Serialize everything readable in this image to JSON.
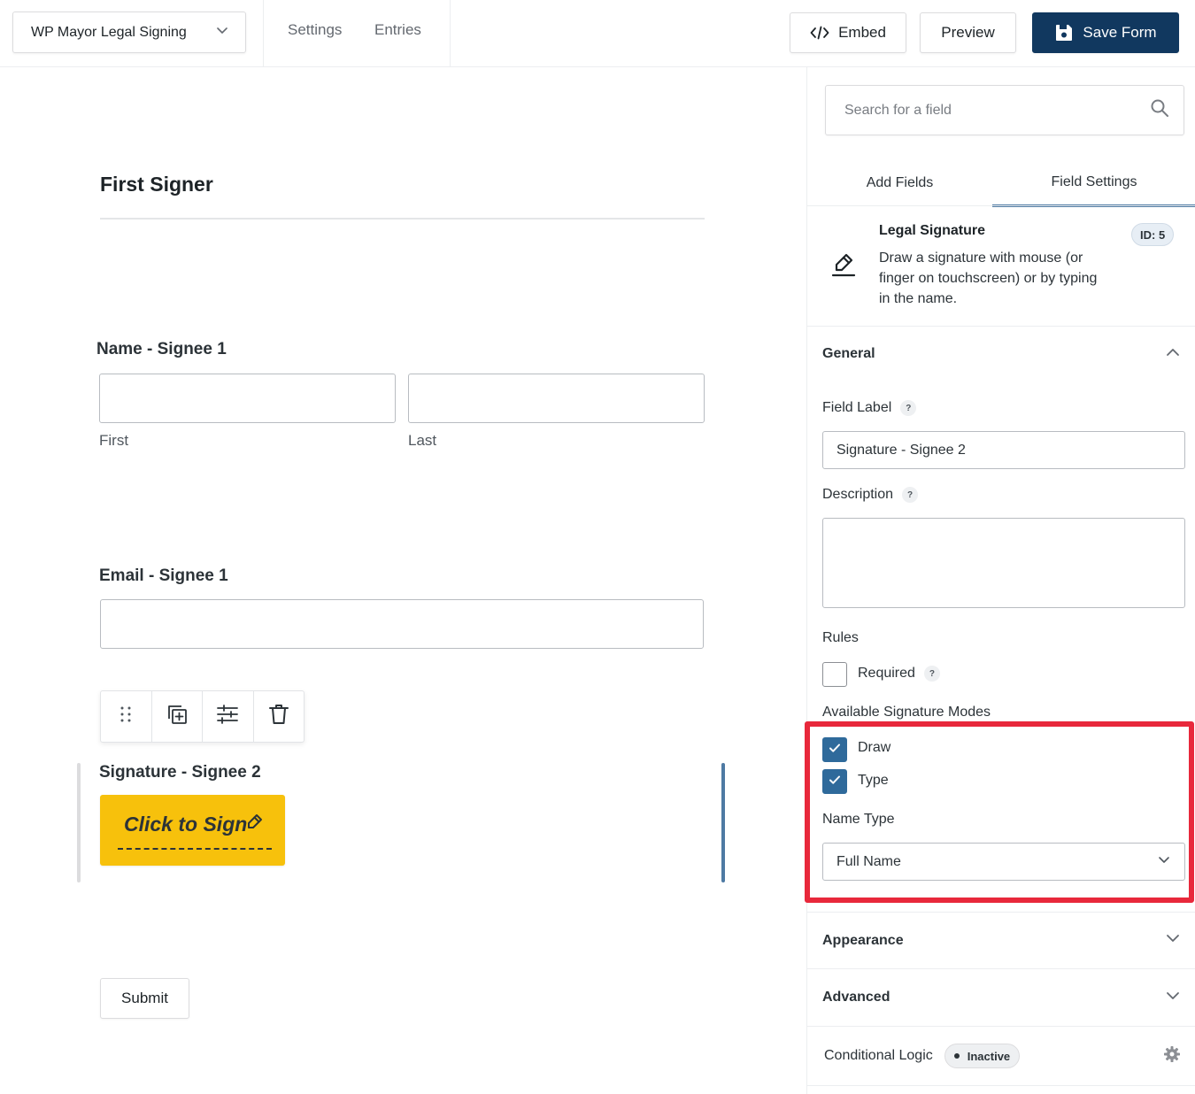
{
  "header": {
    "form_name": "WP Mayor Legal Signing",
    "nav": [
      "Settings",
      "Entries"
    ],
    "embed_label": "Embed",
    "preview_label": "Preview",
    "save_label": "Save Form"
  },
  "canvas": {
    "section_title": "First Signer",
    "name_field": {
      "label": "Name - Signee 1",
      "first_sublabel": "First",
      "last_sublabel": "Last"
    },
    "email_field": {
      "label": "Email - Signee 1"
    },
    "toolbar_icons": [
      "drag-handle-icon",
      "duplicate-icon",
      "settings-sliders-icon",
      "trash-icon"
    ],
    "signature_field": {
      "label": "Signature - Signee 2",
      "button_label": "Click to Sign"
    },
    "submit_label": "Submit"
  },
  "sidebar": {
    "search": {
      "placeholder": "Search for a field"
    },
    "tabs": [
      "Add Fields",
      "Field Settings"
    ],
    "active_tab": "Field Settings",
    "field_info": {
      "title": "Legal Signature",
      "description": "Draw a signature with mouse (or finger on touchscreen) or by typing in the name.",
      "id_badge": "ID: 5"
    },
    "general": {
      "title": "General",
      "field_label_label": "Field Label",
      "field_label_value": "Signature - Signee 2",
      "description_label": "Description",
      "description_value": "",
      "rules_label": "Rules",
      "required_label": "Required",
      "required_checked": false,
      "modes_label": "Available Signature Modes",
      "modes": [
        {
          "label": "Draw",
          "checked": true
        },
        {
          "label": "Type",
          "checked": true
        }
      ],
      "name_type_label": "Name Type",
      "name_type_value": "Full Name",
      "help_mark": "?"
    },
    "appearance_title": "Appearance",
    "advanced_title": "Advanced",
    "conditional": {
      "title": "Conditional Logic",
      "status": "Inactive"
    }
  },
  "colors": {
    "primary": "#11385f",
    "accent": "#4e7aa3",
    "checkbox": "#2f6a9b",
    "sign_button": "#f7c10c",
    "highlight": "#e8283b"
  }
}
